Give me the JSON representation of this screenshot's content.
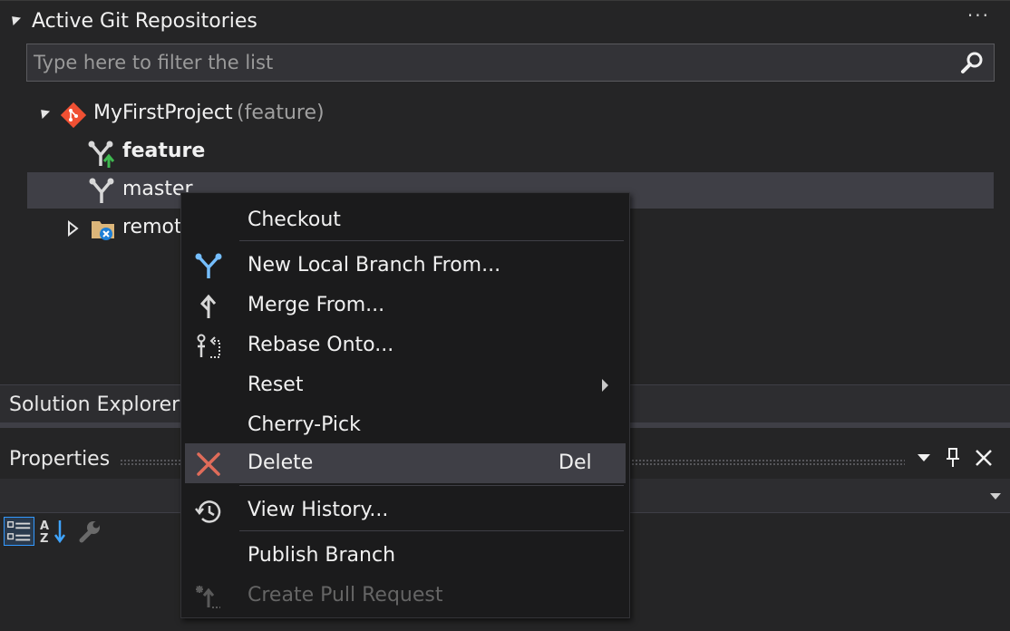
{
  "git_panel": {
    "title": "Active Git Repositories",
    "more_icon": "more-horizontal-icon",
    "filter_placeholder": "Type here to filter the list",
    "repo": {
      "name": "MyFirstProject",
      "current_branch_suffix": "(feature)",
      "icon": "git-repo-icon",
      "branches": [
        {
          "name": "feature",
          "icon": "branch-current-icon",
          "current": true
        },
        {
          "name": "master",
          "icon": "branch-icon",
          "current": false
        }
      ],
      "remote_label": "remot",
      "remote_icon": "remote-folder-icon"
    }
  },
  "solution_explorer": {
    "label": "Solution Explorer"
  },
  "properties": {
    "title": "Properties"
  },
  "context_menu": {
    "items": [
      {
        "label": "Checkout",
        "icon": ""
      },
      {
        "label": "New Local Branch From...",
        "icon": "new-branch-icon"
      },
      {
        "label": "Merge From...",
        "icon": "merge-icon"
      },
      {
        "label": "Rebase Onto...",
        "icon": "rebase-icon"
      },
      {
        "label": "Reset",
        "icon": "",
        "submenu": true
      },
      {
        "label": "Cherry-Pick",
        "icon": ""
      },
      {
        "label": "Delete",
        "icon": "delete-x-icon",
        "shortcut": "Del"
      },
      {
        "label": "View History...",
        "icon": "history-icon"
      },
      {
        "label": "Publish Branch",
        "icon": ""
      },
      {
        "label": "Create Pull Request",
        "icon": "pull-request-icon",
        "disabled": true
      }
    ]
  },
  "colors": {
    "background": "#1e1e1e",
    "panel": "#252526",
    "selected_row": "#3f3f46",
    "git_logo": "#f05033",
    "branch_blue": "#75beff",
    "delete_red": "#e06c5a",
    "green_arrow": "#3fb950"
  }
}
